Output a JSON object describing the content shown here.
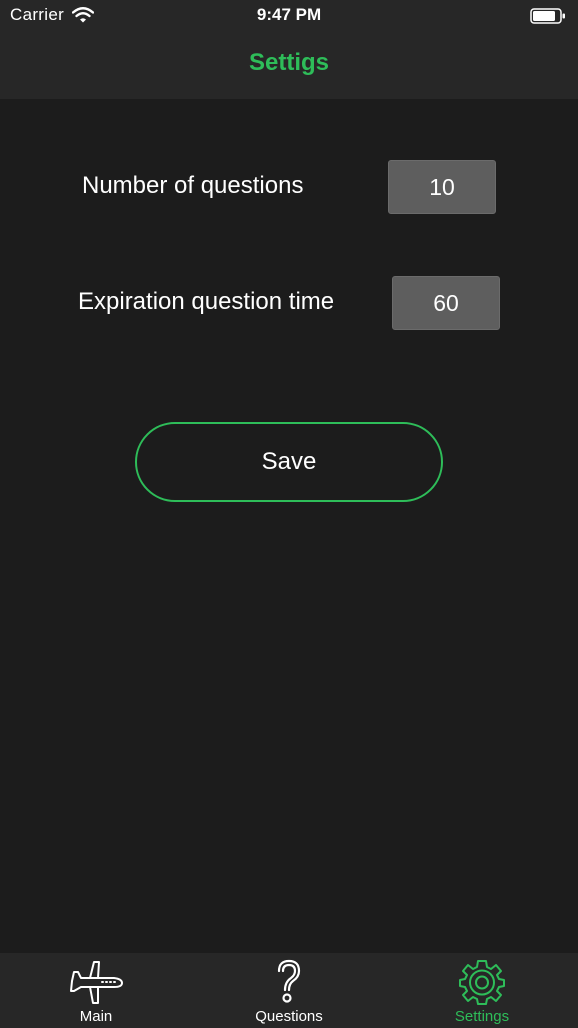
{
  "status_bar": {
    "carrier": "Carrier",
    "time": "9:47 PM"
  },
  "nav": {
    "title": "Settigs"
  },
  "settings": {
    "questions_label": "Number of questions",
    "questions_value": "10",
    "expiration_label": "Expiration question time",
    "expiration_value": "60",
    "save_label": "Save"
  },
  "tabbar": {
    "items": [
      {
        "label": "Main",
        "icon": "airplane-icon",
        "active": false
      },
      {
        "label": "Questions",
        "icon": "question-mark-icon",
        "active": false
      },
      {
        "label": "Settings",
        "icon": "gear-icon",
        "active": true
      }
    ]
  },
  "colors": {
    "accent": "#2ebd59",
    "background": "#1c1c1c",
    "bar_background": "#272727",
    "field_background": "#5e5e5e"
  }
}
